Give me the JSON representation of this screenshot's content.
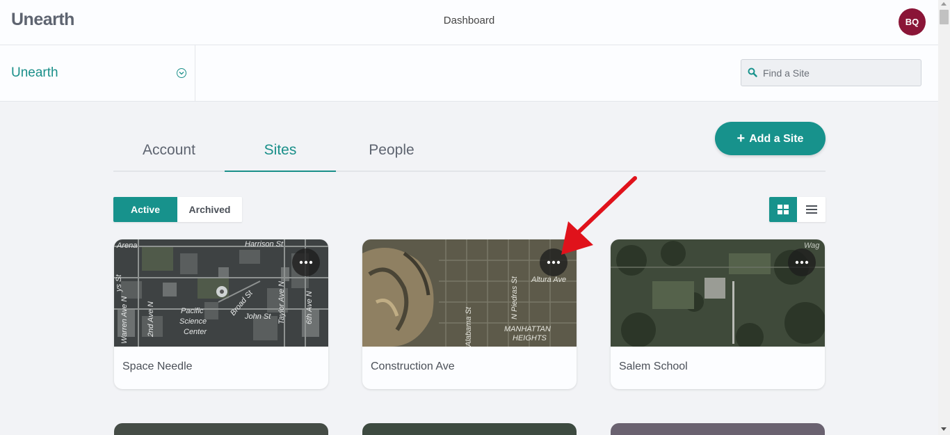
{
  "app": {
    "logo": "Unearth",
    "page_title": "Dashboard",
    "user_initials": "BQ"
  },
  "org_selector": {
    "name": "Unearth",
    "icon": "chevron-down-circle-icon"
  },
  "search": {
    "placeholder": "Find a Site",
    "value": "",
    "icon": "search-icon"
  },
  "tabs": [
    {
      "label": "Account",
      "active": false
    },
    {
      "label": "Sites",
      "active": true
    },
    {
      "label": "People",
      "active": false
    }
  ],
  "add_site_label": "Add a Site",
  "status_filter": {
    "active_label": "Active",
    "archived_label": "Archived",
    "selected": "Active"
  },
  "view_toggle": {
    "selected": "grid",
    "options": [
      "grid-view-icon",
      "list-view-icon"
    ]
  },
  "sites": [
    {
      "name": "Space Needle",
      "map_labels": [
        "Arena",
        "Harrison St",
        "Pacific",
        "Science",
        "Center",
        "Broad St",
        "John St",
        "Taylor Ave N",
        "6th Ave N",
        "Warren Ave N",
        "2nd Ave N",
        "ys St"
      ]
    },
    {
      "name": "Construction Ave",
      "map_labels": [
        "Altura Ave",
        "N Piedras St",
        "Alabama St",
        "MANHATTAN",
        "HEIGHTS"
      ]
    },
    {
      "name": "Salem School",
      "map_labels": [
        "Wag"
      ]
    }
  ],
  "colors": {
    "accent": "#17928c",
    "avatar": "#8a1537",
    "annotation_arrow": "#e0121b"
  }
}
